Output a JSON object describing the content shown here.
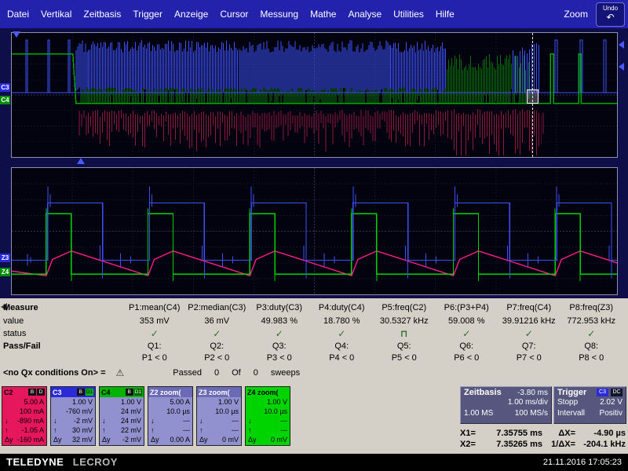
{
  "menu": {
    "items": [
      "Datei",
      "Vertikal",
      "Zeitbasis",
      "Trigger",
      "Anzeige",
      "Cursor",
      "Messung",
      "Mathe",
      "Analyse",
      "Utilities",
      "Hilfe"
    ],
    "zoom_label": "Zoom",
    "undo_label": "Undo"
  },
  "icons": {
    "undo": "↶",
    "warning": "⚠"
  },
  "channel_tags": [
    {
      "label": "C3",
      "bg": "#2a2ae0"
    },
    {
      "label": "C4",
      "bg": "#008c00"
    },
    {
      "label": "Z3",
      "bg": "#2a2ae0"
    },
    {
      "label": "Z4",
      "bg": "#008c00"
    }
  ],
  "colors": {
    "c2": "#8c1a3c",
    "c3": "#3c50ff",
    "c4": "#00a800",
    "c4_dark": "#0b6e0b",
    "z2": "#ff1e8c",
    "z3": "#3c50ff",
    "z4": "#00d400"
  },
  "waveforms": {
    "bottom": {
      "cycle_starts": [
        44,
        174,
        304,
        434,
        564,
        694
      ],
      "period": 130,
      "green_width": 32,
      "blue_width": 70
    }
  },
  "measure": {
    "row_labels": {
      "measure": "Measure",
      "value": "value",
      "status": "status",
      "passfail": "Pass/Fail"
    },
    "columns": [
      {
        "param": "P1:mean(C4)",
        "value": "353 mV",
        "status": "✓",
        "q": "Q1:",
        "condition": "P1 < 0"
      },
      {
        "param": "P2:median(C3)",
        "value": "36 mV",
        "status": "✓",
        "q": "Q2:",
        "condition": "P2 < 0"
      },
      {
        "param": "P3:duty(C3)",
        "value": "49.983 %",
        "status": "✓",
        "q": "Q3:",
        "condition": "P3 < 0"
      },
      {
        "param": "P4:duty(C4)",
        "value": "18.780 %",
        "status": "✓",
        "q": "Q4:",
        "condition": "P4 < 0"
      },
      {
        "param": "P5:freq(C2)",
        "value": "30.5327 kHz",
        "status": "⊓",
        "q": "Q5:",
        "condition": "P5 < 0"
      },
      {
        "param": "P6:(P3+P4)",
        "value": "59.008 %",
        "status": "✓",
        "q": "Q6:",
        "condition": "P6 < 0"
      },
      {
        "param": "P7:freq(C4)",
        "value": "39.91216 kHz",
        "status": "✓",
        "q": "Q7:",
        "condition": "P7 < 0"
      },
      {
        "param": "P8:freq(Z3)",
        "value": "772.953 kHz",
        "status": "✓",
        "q": "Q8:",
        "condition": "P8 < 0"
      }
    ]
  },
  "qx": {
    "text": "<no Qx conditions On> =",
    "passed_label": "Passed",
    "passed_count": "0",
    "of_label": "Of",
    "sweep_count": "0",
    "sweeps_label": "sweeps"
  },
  "descriptors": [
    {
      "id": "C2",
      "name": "C2",
      "header_bg": "#e6175c",
      "header_fg": "#000",
      "body_bg": "#e6175c",
      "body_fg": "#000",
      "badges": [
        {
          "text": "B",
          "bg": "#141414",
          "fg": "#fff"
        },
        {
          "text": "D",
          "bg": "#141414",
          "fg": "#fff"
        }
      ],
      "rows": [
        [
          "",
          "5.00 A"
        ],
        [
          "",
          "100 mA"
        ],
        [
          "↓",
          "-890 mA"
        ],
        [
          "↑",
          "-1.05 A"
        ],
        [
          "Δy",
          "-160 mA"
        ]
      ]
    },
    {
      "id": "C3",
      "name": "C3",
      "header_bg": "#2a2ad8",
      "header_fg": "#fff",
      "body_bg": "#9191cf",
      "body_fg": "#000",
      "badges": [
        {
          "text": "B",
          "bg": "#141414",
          "fg": "#fff"
        },
        {
          "text": "D1",
          "bg": "#00b400",
          "fg": "#000"
        }
      ],
      "rows": [
        [
          "",
          "1.00 V"
        ],
        [
          "",
          "-760 mV"
        ],
        [
          "↓",
          "-2 mV"
        ],
        [
          "↑",
          "30 mV"
        ],
        [
          "Δy",
          "32 mV"
        ]
      ]
    },
    {
      "id": "C4",
      "name": "C4",
      "header_bg": "#00b400",
      "header_fg": "#000",
      "body_bg": "#9191cf",
      "body_fg": "#000",
      "badges": [
        {
          "text": "B",
          "bg": "#141414",
          "fg": "#fff"
        },
        {
          "text": "D1",
          "bg": "#006400",
          "fg": "#fff"
        }
      ],
      "rows": [
        [
          "",
          "1.00 V"
        ],
        [
          "",
          "24 mV"
        ],
        [
          "↓",
          "24 mV"
        ],
        [
          "↑",
          "22 mV"
        ],
        [
          "Δy",
          "-2 mV"
        ]
      ]
    },
    {
      "id": "Z2",
      "name": "Z2 zoom(",
      "header_bg": "#6a6ab6",
      "header_fg": "#fff",
      "body_bg": "#9191cf",
      "body_fg": "#000",
      "badges": [],
      "rows": [
        [
          "",
          "5.00 A"
        ],
        [
          "",
          "10.0 µs"
        ],
        [
          "↓",
          "---"
        ],
        [
          "↑",
          "---"
        ],
        [
          "Δy",
          "0.00 A"
        ]
      ]
    },
    {
      "id": "Z3",
      "name": "Z3 zoom(",
      "header_bg": "#6a6ab6",
      "header_fg": "#fff",
      "body_bg": "#9191cf",
      "body_fg": "#000",
      "badges": [],
      "rows": [
        [
          "",
          "1.00 V"
        ],
        [
          "",
          "10.0 µs"
        ],
        [
          "↓",
          "---"
        ],
        [
          "↑",
          "---"
        ],
        [
          "Δy",
          "0 mV"
        ]
      ]
    },
    {
      "id": "Z4",
      "name": "Z4 zoom(",
      "header_bg": "#00d400",
      "header_fg": "#000",
      "body_bg": "#00d400",
      "body_fg": "#000",
      "badges": [],
      "rows": [
        [
          "",
          "1.00 V"
        ],
        [
          "",
          "10.0 µs"
        ],
        [
          "↓",
          "---"
        ],
        [
          "↑",
          "---"
        ],
        [
          "Δy",
          "0 mV"
        ]
      ]
    }
  ],
  "timebase": {
    "title": "Zeitbasis",
    "offset": "-3.80 ms",
    "scale": "1.00 ms/div",
    "samples": "1.00 MS",
    "rate": "100 MS/s"
  },
  "trigger": {
    "title": "Trigger",
    "badge_source": "C3",
    "badge_coupling": "DC",
    "mode": "Stopp",
    "level": "2.02 V",
    "type": "Intervall",
    "slope": "Positiv"
  },
  "cursors": {
    "x1_label": "X1=",
    "x1": "7.35755 ms",
    "x2_label": "X2=",
    "x2": "7.35265 ms",
    "dx_label": "ΔX=",
    "dx": "-4.90 µs",
    "inv_label": "1/ΔX=",
    "inv": "-204.1 kHz"
  },
  "footer": {
    "brand_1": "TELEDYNE",
    "brand_2": "LECROY",
    "datetime": "21.11.2016 17:05:23"
  }
}
